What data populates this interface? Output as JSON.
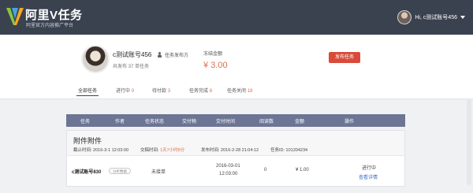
{
  "header": {
    "brand_title": "阿里V任务",
    "brand_subtitle": "阿里官方内容推广平台",
    "user_label": "Hi, c测试账号456"
  },
  "profile": {
    "account_name": "c测试账号456",
    "role": "任务发布方",
    "published": "共发布 37 单任务",
    "frozen_label": "冻结金额",
    "frozen_amount": "¥ 3.00",
    "publish_button": "发布任务"
  },
  "tabs": [
    {
      "label": "全部任务",
      "count": ""
    },
    {
      "label": "进行中",
      "count": "0"
    },
    {
      "label": "待付款",
      "count": "3"
    },
    {
      "label": "任务完成",
      "count": "8"
    },
    {
      "label": "任务关闭",
      "count": "18"
    }
  ],
  "table": {
    "headers": [
      "任务",
      "作者",
      "任务状态",
      "交付物",
      "交付时间",
      "阅读数",
      "金额",
      "操作"
    ]
  },
  "task": {
    "title": "附件附件",
    "deadline_label": "截止时间: 2016-3-1 12:03:00",
    "delivery_label": "交稿时间:",
    "delivery_value": "1天7小时8分",
    "publish_time": "发布时间: 2016-2-28 21:04:12",
    "task_id": "任务ID: 101204234",
    "row": {
      "account": "c测试账号830",
      "tag": "分析数据",
      "status": "未接单",
      "delivery_date": "2016-03-01",
      "delivery_clock": "12:03:00",
      "reads": "0",
      "amount": "¥ 1.00",
      "action_status": "进行中",
      "action_link": "查看详情"
    }
  },
  "colors": {
    "topbar": "#3a4250",
    "accent_red": "#d94a3a",
    "table_header": "#6c7594"
  }
}
